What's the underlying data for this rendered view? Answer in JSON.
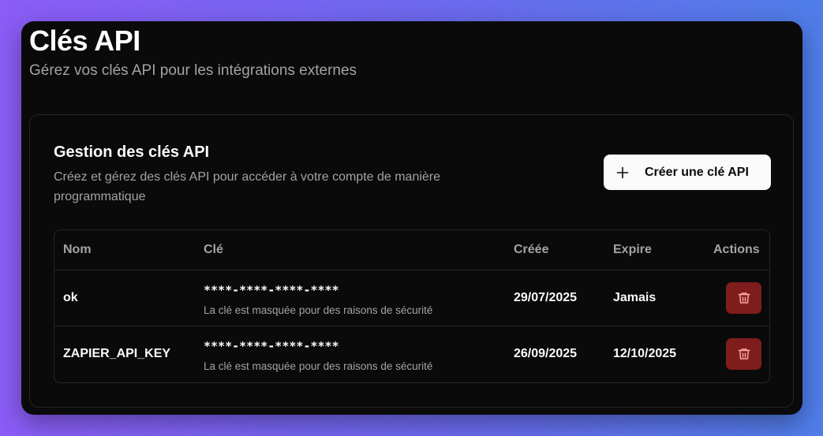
{
  "page": {
    "title": "Clés API",
    "subtitle": "Gérez vos clés API pour les intégrations externes"
  },
  "card": {
    "title": "Gestion des clés API",
    "description": "Créez et gérez des clés API pour accéder à votre compte de manière programmatique",
    "create_button_label": "Créer une clé API",
    "create_button_icon": "plus-icon"
  },
  "table": {
    "headers": {
      "name": "Nom",
      "key": "Clé",
      "created": "Créée",
      "expires": "Expire",
      "actions": "Actions"
    },
    "rows": [
      {
        "name": "ok",
        "key": "****-****-****-****",
        "key_note": "La clé est masquée pour des raisons de sécurité",
        "created": "29/07/2025",
        "expires": "Jamais",
        "action_icon": "trash-icon"
      },
      {
        "name": "ZAPIER_API_KEY",
        "key": "****-****-****-****",
        "key_note": "La clé est masquée pour des raisons de sécurité",
        "created": "26/09/2025",
        "expires": "12/10/2025",
        "action_icon": "trash-icon"
      }
    ]
  },
  "colors": {
    "background_start": "#8b5cf6",
    "background_end": "#4f7de8",
    "window": "#0a0a0a",
    "delete_button": "#7f1d1d",
    "delete_icon": "#fca5a5"
  }
}
